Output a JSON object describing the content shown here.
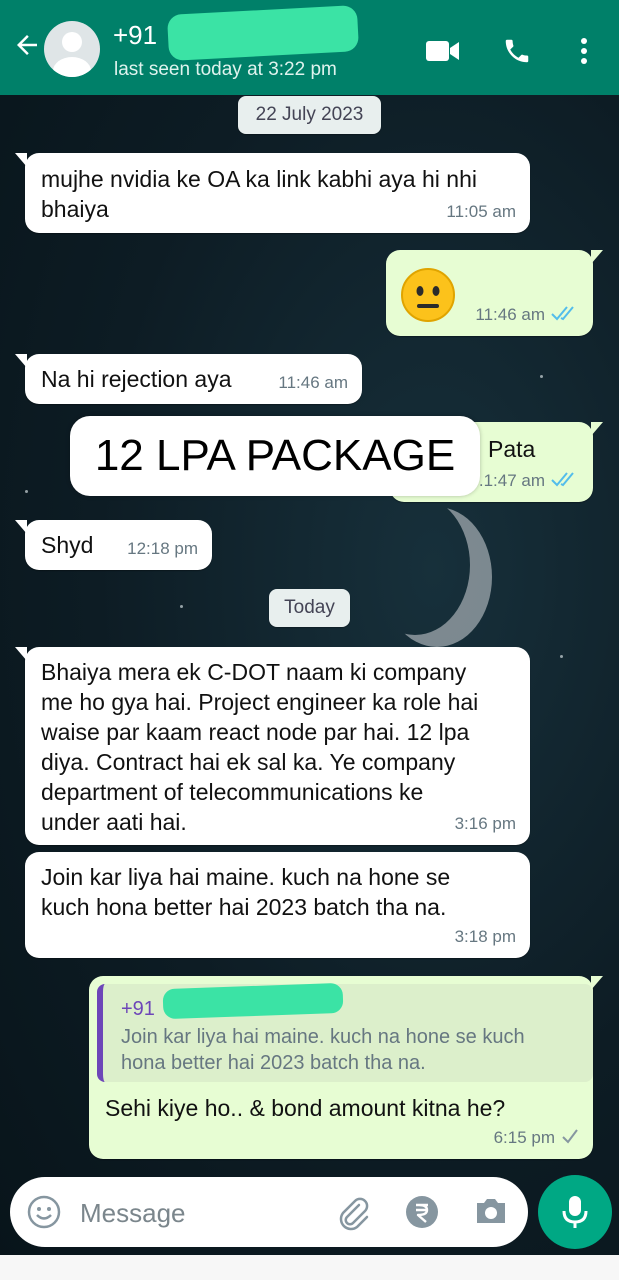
{
  "header": {
    "contact_name": "+91",
    "status": "last seen today at 3:22 pm",
    "icons": [
      "back-arrow-icon",
      "avatar",
      "video-call-icon",
      "phone-icon",
      "more-options-icon"
    ],
    "color": "#008069"
  },
  "dates": {
    "first": "22 July 2023",
    "second": "Today"
  },
  "messages": [
    {
      "dir": "in",
      "text_lines": [
        "mujhe nvidia ke OA ka link kabhi aya hi nhi",
        "bhaiya"
      ],
      "time": "11:05 am"
    },
    {
      "dir": "out",
      "emoji": "neutral-face",
      "time": "11:46 am",
      "ticks": "read"
    },
    {
      "dir": "in",
      "text": "Na hi rejection aya",
      "time": "11:46 am"
    },
    {
      "dir": "out",
      "text": "Pata",
      "time": ".1:47 am",
      "ticks": "read"
    },
    {
      "dir": "in",
      "text": "Shyd",
      "time": "12:18 pm"
    },
    {
      "dir": "in",
      "text_lines": [
        "Bhaiya mera ek C-DOT naam ki company",
        "me ho gya hai. Project engineer ka role hai",
        "waise par kaam react node par hai. 12 lpa",
        "diya. Contract hai ek sal ka. Ye company",
        "department of telecommunications ke",
        "under aati hai."
      ],
      "time": "3:16 pm"
    },
    {
      "dir": "in",
      "text_lines": [
        "Join kar liya hai maine. kuch na hone se",
        "kuch hona better hai 2023 batch tha na."
      ],
      "time": "3:18 pm"
    },
    {
      "dir": "out",
      "reply_to": {
        "name": "+91",
        "text_lines": [
          "Join kar liya hai maine. kuch na hone se kuch",
          "hona better hai 2023 batch tha na."
        ]
      },
      "text": "Sehi kiye ho.. & bond amount kitna he?",
      "time": "6:15 pm",
      "ticks": "delivered"
    }
  ],
  "overlay_caption": "12 LPA PACKAGE",
  "composer": {
    "placeholder": "Message",
    "icons": [
      "emoji-icon",
      "attach-icon",
      "rupee-payment-icon",
      "camera-icon",
      "mic-icon"
    ],
    "accent": "#00a884"
  },
  "colors": {
    "incoming_bubble": "#ffffff",
    "outgoing_bubble": "#e7fdd3",
    "read_tick": "#53bdeb"
  }
}
